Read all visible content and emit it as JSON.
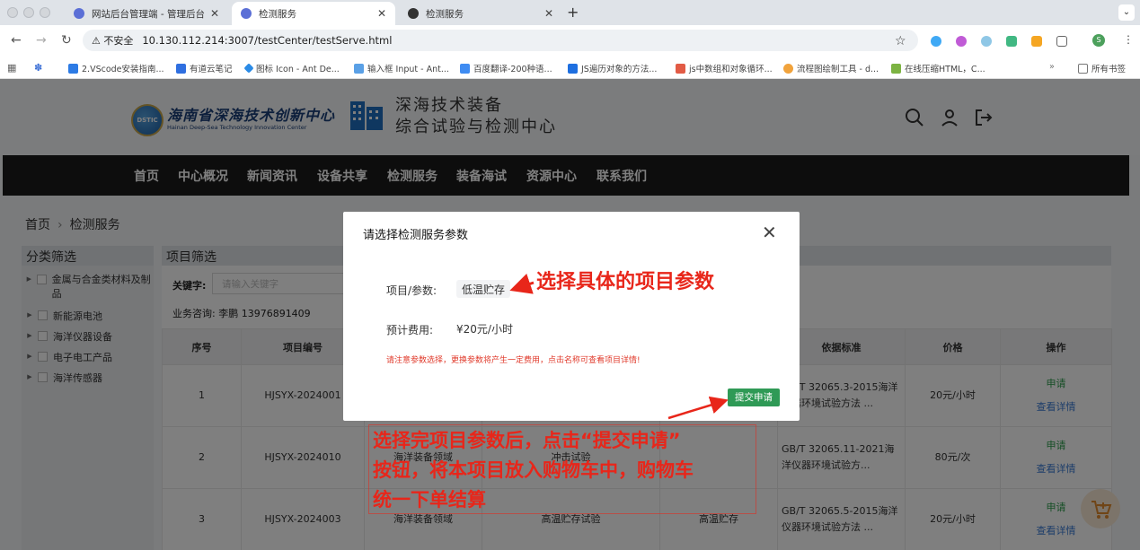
{
  "browser": {
    "tabs": [
      {
        "label": "网站后台管理端 - 管理后台",
        "active": false
      },
      {
        "label": "检测服务",
        "active": true
      },
      {
        "label": "检测服务",
        "active": false
      }
    ],
    "new_tab": "+",
    "address": {
      "security": "⚠ 不安全",
      "url": "10.130.112.214:3007/testCenter/testServe.html"
    },
    "profile_initial": "S",
    "bookmarks": [
      "2.VScode安装指南...",
      "有道云笔记",
      "图标 Icon - Ant De...",
      "输入框 Input - Ant...",
      "百度翻译-200种语...",
      "JS遍历对象的方法...",
      "js中数组和对象循环...",
      "流程图绘制工具 - d...",
      "在线压缩HTML，C..."
    ],
    "bookmarks_overflow": "»",
    "all_bookmarks": "所有书签"
  },
  "site": {
    "logo_cn": "海南省深海技术创新中心",
    "logo_en": "Hainan Deep-Sea Technology Innovation Center",
    "logo_badge": "DSTIC",
    "center_line1": "深海技术装备",
    "center_line2": "综合试验与检测中心",
    "nav": [
      "首页",
      "中心概况",
      "新闻资讯",
      "设备共享",
      "检测服务",
      "装备海试",
      "资源中心",
      "联系我们"
    ],
    "breadcrumb": {
      "home": "首页",
      "sep": "›",
      "current": "检测服务"
    }
  },
  "filter": {
    "title": "分类筛选",
    "categories": [
      "金属与合金类材料及制品",
      "新能源电池",
      "海洋仪器设备",
      "电子电工产品",
      "海洋传感器"
    ]
  },
  "project": {
    "title": "项目筛选",
    "keyword_label": "关键字:",
    "keyword_placeholder": "请输入关键字",
    "contact": "业务咨询: 李鹏 13976891409",
    "columns": [
      "序号",
      "项目编号",
      "",
      "",
      "",
      "依据标准",
      "价格",
      "操作"
    ],
    "rows": [
      {
        "no": "1",
        "code": "HJSYX-2024001",
        "field": "",
        "test": "",
        "param": "",
        "standard": "GB/T 32065.3-2015海洋仪器环境试验方法 ...",
        "price": "20元/小时",
        "apply": "申请",
        "view": "查看详情"
      },
      {
        "no": "2",
        "code": "HJSYX-2024010",
        "field": "海洋装备领域",
        "test": "冲击试验",
        "param": "",
        "standard": "GB/T 32065.11-2021海洋仪器环境试验方...",
        "price": "80元/次",
        "apply": "申请",
        "view": "查看详情"
      },
      {
        "no": "3",
        "code": "HJSYX-2024003",
        "field": "海洋装备领域",
        "test": "高温贮存试验",
        "param": "高温贮存",
        "standard": "GB/T 32065.5-2015海洋仪器环境试验方法 ...",
        "price": "20元/小时",
        "apply": "申请",
        "view": "查看详情"
      }
    ]
  },
  "modal": {
    "title": "请选择检测服务参数",
    "close": "✕",
    "param_label": "项目/参数:",
    "param_value": "低温贮存",
    "fee_label": "预计费用:",
    "fee_value": "¥20元/小时",
    "notice": "请注意参数选择，更换参数将产生一定费用，点击名称可查看项目详情!",
    "submit": "提交申请"
  },
  "annotations": {
    "top": "选择具体的项目参数",
    "bottom_lines": [
      "选择完项目参数后，点击“提交申请”",
      "按钮，将本项目放入购物车中，购物车",
      "统一下单结算"
    ]
  },
  "colors": {
    "accent_green": "#2f9a56",
    "annotation_red": "#e8261a",
    "nav_bg": "#1a1a1a"
  }
}
